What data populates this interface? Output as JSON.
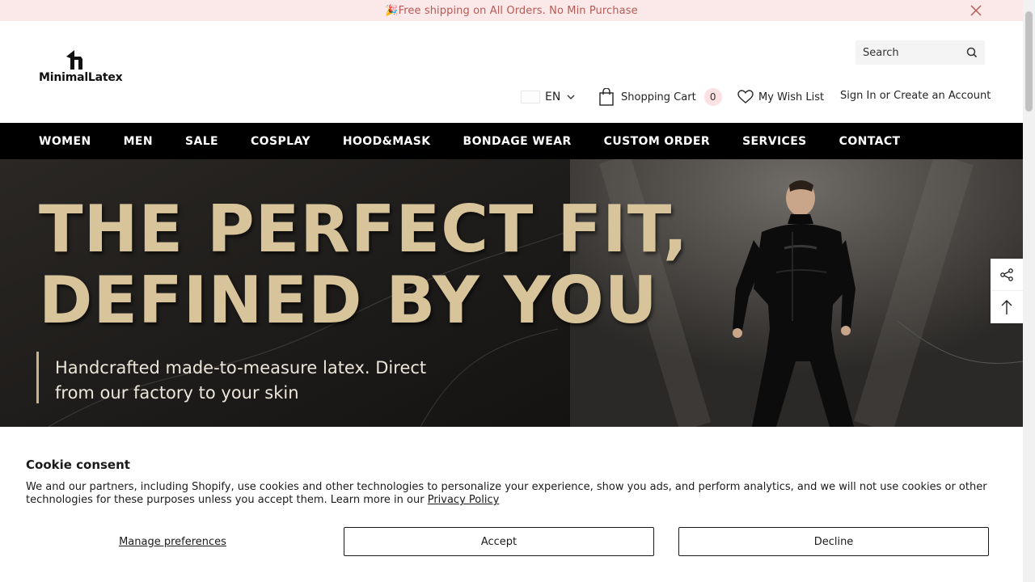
{
  "announcement": {
    "text": "🎉Free shipping on All Orders. No Min Purchase",
    "close_icon": "close-icon"
  },
  "header": {
    "logo_text": "MinimalLatex",
    "search": {
      "placeholder": "Search",
      "value": ""
    },
    "language": {
      "code": "EN"
    },
    "cart": {
      "label": "Shopping Cart",
      "count": "0"
    },
    "wishlist": {
      "label": "My Wish List"
    },
    "account": {
      "sign_in": "Sign In",
      "separator": "or",
      "create": "Create an Account"
    }
  },
  "nav": {
    "items": [
      {
        "label": "WOMEN"
      },
      {
        "label": "MEN"
      },
      {
        "label": "SALE"
      },
      {
        "label": "COSPLAY"
      },
      {
        "label": "HOOD&MASK"
      },
      {
        "label": "BONDAGE WEAR"
      },
      {
        "label": "CUSTOM ORDER"
      },
      {
        "label": "SERVICES"
      },
      {
        "label": "CONTACT"
      }
    ]
  },
  "hero": {
    "line1": "THE PERFECT FIT,",
    "line2": "DEFINED BY YOU",
    "subtitle": "Handcrafted made-to-measure latex. Direct from our factory to your skin"
  },
  "side_tools": {
    "icons": [
      "share-icon",
      "arrow-up-icon"
    ]
  },
  "cookie": {
    "title": "Cookie consent",
    "text": "We and our partners, including Shopify, use cookies and other technologies to personalize your experience, show you ads, and perform analytics, and we will not use cookies or other technologies for these purposes unless you accept them. Learn more in our",
    "link": "Privacy Policy",
    "manage": "Manage preferences",
    "accept": "Accept",
    "decline": "Decline"
  },
  "colors": {
    "announce_bg": "#fbe9e9",
    "announce_text": "#b55a54",
    "nav_bg": "#000000",
    "hero_gold": "#d8c49b",
    "cart_badge": "#fbe1e1"
  }
}
